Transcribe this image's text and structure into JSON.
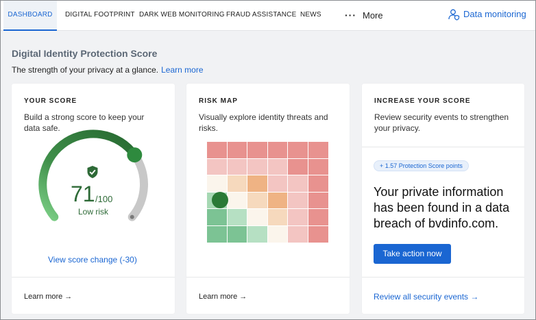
{
  "nav": {
    "tabs": [
      {
        "label": "DASHBOARD"
      },
      {
        "label": "DIGITAL FOOTPRINT"
      },
      {
        "label": "DARK WEB MONITORING"
      },
      {
        "label": "FRAUD ASSISTANCE"
      },
      {
        "label": "NEWS"
      }
    ],
    "more_label": "More",
    "more_icon": "ellipsis-icon",
    "data_monitoring_label": "Data monitoring",
    "data_monitoring_icon": "user-shield-icon"
  },
  "header": {
    "title": "Digital Identity Protection Score",
    "subtitle": "The strength of your privacy at a glance.",
    "learn_more": "Learn more"
  },
  "score_card": {
    "heading": "YOUR SCORE",
    "description_line1": "Build a strong score to keep your",
    "description_line2": "data safe.",
    "score": "71",
    "score_max": "/100",
    "score_fraction": 0.71,
    "risk_label": "Low risk",
    "score_change_link": "View score change (-30)",
    "footer_link": "Learn more →",
    "icon": "shield-check-icon"
  },
  "risk_card": {
    "heading": "RISK MAP",
    "description_line1": "Visually explore identity threats and",
    "description_line2": "risks.",
    "footer_link": "Learn more →",
    "heatmap_colors": [
      [
        "#e8928f",
        "#e8928f",
        "#e8928f",
        "#e8928f",
        "#e8928f",
        "#e8928f"
      ],
      [
        "#f3c5c2",
        "#f3c5c2",
        "#f3c5c2",
        "#f3c5c2",
        "#e8928f",
        "#e8928f"
      ],
      [
        "#fbf5ec",
        "#f6d9bd",
        "#efb384",
        "#f3c5c2",
        "#f3c5c2",
        "#e8928f"
      ],
      [
        "#a6d8b3",
        "#fbf5ec",
        "#f6d9bd",
        "#efb384",
        "#f3c5c2",
        "#e8928f"
      ],
      [
        "#7cc394",
        "#b6e0c3",
        "#fbf5ec",
        "#f6d9bd",
        "#f3c5c2",
        "#e8928f"
      ],
      [
        "#7cc394",
        "#7cc394",
        "#b6e0c3",
        "#fbf5ec",
        "#f3c5c2",
        "#e8928f"
      ]
    ],
    "marker_cell": [
      3,
      0
    ]
  },
  "increase_card": {
    "heading": "INCREASE YOUR SCORE",
    "description_line1": "Review security events to strengthen",
    "description_line2": "your privacy.",
    "badge": "+ 1.57 Protection Score points",
    "headline_line1": "Your private information",
    "headline_line2": "has been found in a data",
    "headline_line3": "breach of bvdinfo.com.",
    "cta_label": "Take action now",
    "footer_link": "Review all security events →"
  },
  "colors": {
    "accent": "#1a66d2",
    "score_green": "#2e6a37",
    "gauge_track": "#c8c8c8"
  }
}
